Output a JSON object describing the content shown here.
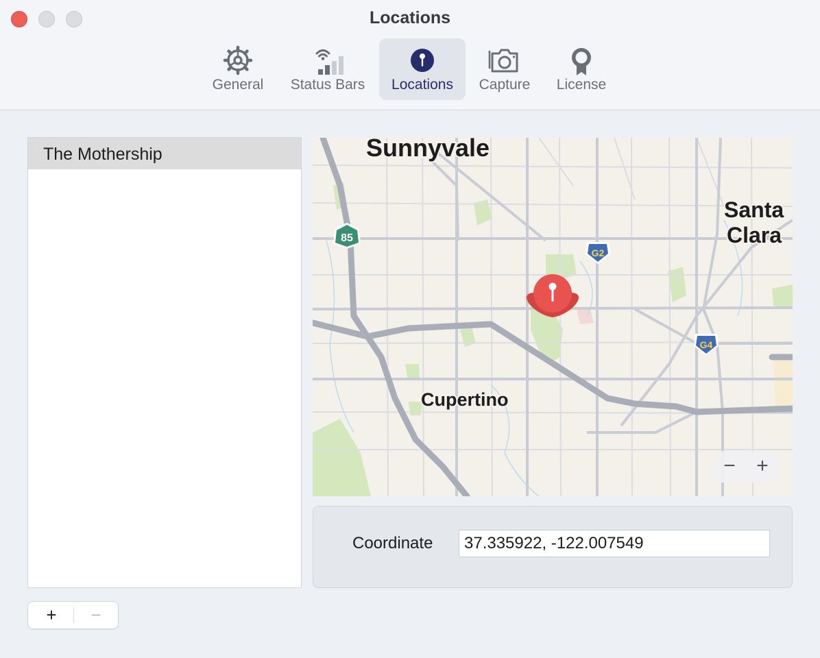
{
  "window": {
    "title": "Locations",
    "traffic_lights": {
      "close_color": "#ee5f57",
      "minimize_color": "#dcdde0",
      "zoom_color": "#dcdde0"
    }
  },
  "tabs": [
    {
      "label": "General",
      "icon": "gear-icon",
      "active": false
    },
    {
      "label": "Status Bars",
      "icon": "signal-bars-icon",
      "active": false
    },
    {
      "label": "Locations",
      "icon": "location-pin-icon",
      "active": true
    },
    {
      "label": "Capture",
      "icon": "camera-icon",
      "active": false
    },
    {
      "label": "License",
      "icon": "ribbon-badge-icon",
      "active": false
    }
  ],
  "locations_list": {
    "items": [
      {
        "name": "The Mothership",
        "selected": true
      }
    ],
    "add_label": "+",
    "remove_label": "−"
  },
  "map": {
    "labels": {
      "city1": "Sunnyvale",
      "city2": "Santa",
      "city2b": "Clara",
      "city3": "Cupertino",
      "shield_85": "85",
      "shield_g2": "G2",
      "shield_g4": "G4"
    },
    "zoom_out_label": "−",
    "zoom_in_label": "+",
    "pin_color": "#e8534f",
    "park_color": "#cfe4b4",
    "road_color": "#c2c6cf"
  },
  "coordinate": {
    "label": "Coordinate",
    "value": "37.335922, -122.007549"
  }
}
